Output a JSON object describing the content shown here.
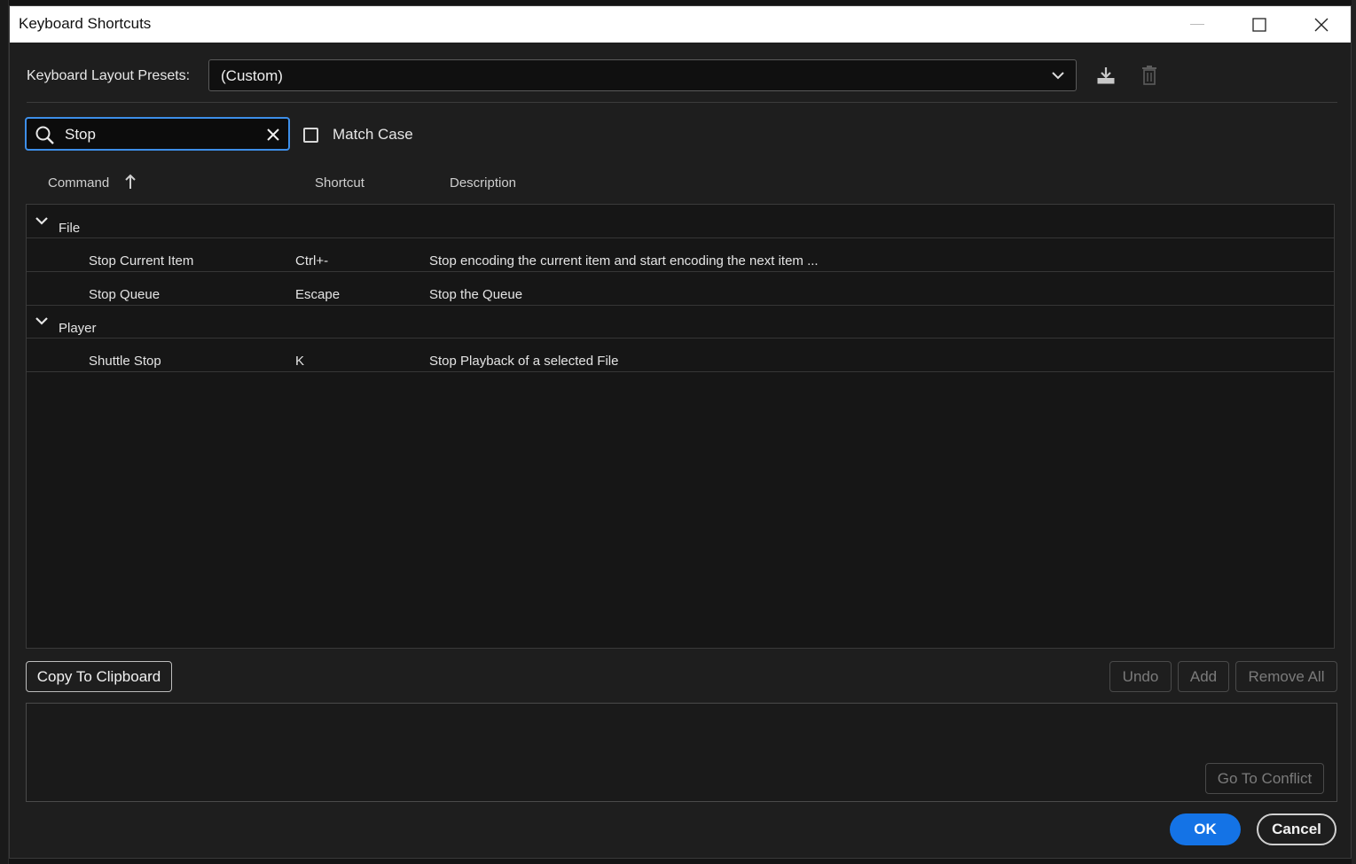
{
  "window": {
    "title": "Keyboard Shortcuts"
  },
  "presets": {
    "label": "Keyboard Layout Presets:",
    "selected": "(Custom)"
  },
  "search": {
    "value": "Stop",
    "match_case_label": "Match Case",
    "match_case_checked": false
  },
  "columns": {
    "command": "Command",
    "shortcut": "Shortcut",
    "description": "Description"
  },
  "groups": [
    {
      "name": "File",
      "items": [
        {
          "command": "Stop Current Item",
          "shortcut": "Ctrl+-",
          "description": "Stop encoding the current item and start encoding the next item ..."
        },
        {
          "command": "Stop Queue",
          "shortcut": "Escape",
          "description": "Stop the Queue"
        }
      ]
    },
    {
      "name": "Player",
      "items": [
        {
          "command": "Shuttle Stop",
          "shortcut": "K",
          "description": "Stop Playback of a selected File"
        }
      ]
    }
  ],
  "buttons": {
    "copy": "Copy To Clipboard",
    "undo": "Undo",
    "add": "Add",
    "remove_all": "Remove All",
    "go_to_conflict": "Go To Conflict",
    "ok": "OK",
    "cancel": "Cancel"
  },
  "colors": {
    "accent": "#1473e6",
    "focus": "#3d8ee8",
    "panel": "#1e1e1e"
  },
  "icons": [
    "minimize-icon",
    "maximize-icon",
    "close-icon",
    "chevron-down-icon",
    "save-preset-icon",
    "trash-icon",
    "search-icon",
    "clear-icon",
    "sort-ascending-icon"
  ]
}
